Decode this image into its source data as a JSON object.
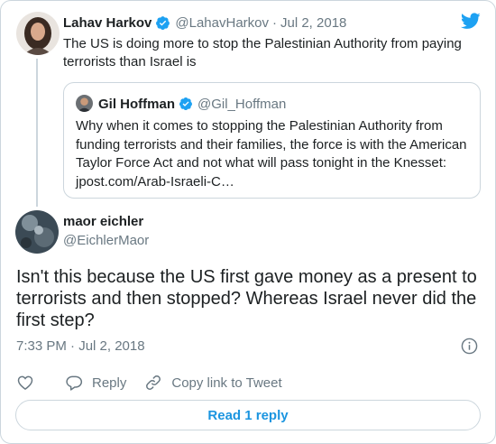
{
  "colors": {
    "accent": "#1b95e0",
    "verified": "#1da1f2",
    "secondary_text": "#697882",
    "border": "#ccd6dd",
    "primary_text": "#1c2022"
  },
  "parent_tweet": {
    "name": "Lahav Harkov",
    "handle": "@LahavHarkov",
    "separator": "·",
    "date": "Jul 2, 2018",
    "text": "The US is doing more to stop the Palestinian Authority from paying terrorists than Israel is",
    "verified_icon": "verified-badge-icon",
    "logo_icon": "twitter-bird-icon"
  },
  "quoted_tweet": {
    "name": "Gil Hoffman",
    "handle": "@Gil_Hoffman",
    "text": "Why when it comes to stopping the Palestinian Authority from funding terrorists and their families, the force is with the American Taylor Force Act and not what will pass tonight in the Knesset: jpost.com/Arab-Israeli-C…",
    "verified_icon": "verified-badge-icon"
  },
  "main_tweet": {
    "name": "maor eichler",
    "handle": "@EichlerMaor",
    "text": "Isn't this because the US first gave money as a present to terrorists and then stopped? Whereas Israel never did the first step?",
    "time": "7:33 PM · Jul 2, 2018",
    "info_icon": "info-icon"
  },
  "actions": {
    "like_icon": "heart-icon",
    "reply_label": "Reply",
    "reply_icon": "reply-bubble-icon",
    "copy_label": "Copy link to Tweet",
    "copy_icon": "link-icon"
  },
  "read_replies_label": "Read 1 reply"
}
